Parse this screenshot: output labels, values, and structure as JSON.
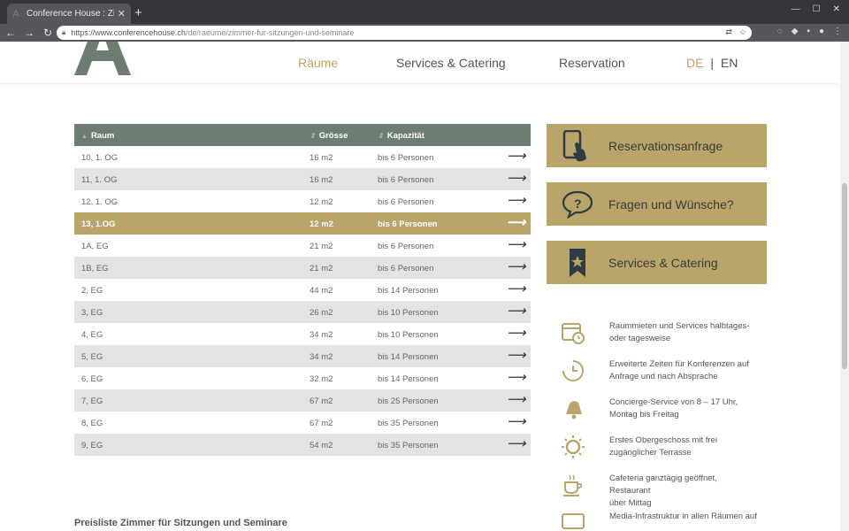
{
  "browser": {
    "tab_title": "Conference House : Zimm",
    "url_host": "https://www.conferencehouse.ch",
    "url_path": "/de/raeume/zimmer-fur-sitzungen-und-seminare"
  },
  "nav": {
    "items": [
      "Räume",
      "Services & Catering",
      "Reservation"
    ],
    "lang_de": "DE",
    "lang_sep": "|",
    "lang_en": "EN"
  },
  "table": {
    "headers": [
      "Raum",
      "Grösse",
      "Kapazität"
    ],
    "rows": [
      {
        "raum": "10, 1. OG",
        "groesse": "16 m2",
        "kapazitaet": "bis 6 Personen"
      },
      {
        "raum": "11, 1. OG",
        "groesse": "16 m2",
        "kapazitaet": "bis 6 Personen"
      },
      {
        "raum": "12, 1. OG",
        "groesse": "12 m2",
        "kapazitaet": "bis 6 Personen"
      },
      {
        "raum": "13, 1.OG",
        "groesse": "12 m2",
        "kapazitaet": "bis 6 Personen"
      },
      {
        "raum": "1A, EG",
        "groesse": "21 m2",
        "kapazitaet": "bis 6 Personen"
      },
      {
        "raum": "1B, EG",
        "groesse": "21 m2",
        "kapazitaet": "bis 6 Personen"
      },
      {
        "raum": "2, EG",
        "groesse": "44 m2",
        "kapazitaet": "bis 14 Personen"
      },
      {
        "raum": "3, EG",
        "groesse": "26 m2",
        "kapazitaet": "bis 10 Personen"
      },
      {
        "raum": "4, EG",
        "groesse": "34 m2",
        "kapazitaet": "bis 10 Personen"
      },
      {
        "raum": "5, EG",
        "groesse": "34 m2",
        "kapazitaet": "bis 14 Personen"
      },
      {
        "raum": "6, EG",
        "groesse": "32 m2",
        "kapazitaet": "bis 14 Personen"
      },
      {
        "raum": "7, EG",
        "groesse": "67 m2",
        "kapazitaet": "bis 25 Personen"
      },
      {
        "raum": "8, EG",
        "groesse": "67 m2",
        "kapazitaet": "bis 35 Personen"
      },
      {
        "raum": "9, EG",
        "groesse": "54 m2",
        "kapazitaet": "bis 35 Personen"
      }
    ]
  },
  "price_title": "Preisliste Zimmer für Sitzungen und Seminare",
  "cards": [
    {
      "label": "Reservationsanfrage",
      "icon": "touch-phone-icon"
    },
    {
      "label": "Fragen und Wünsche?",
      "icon": "question-bubble-icon"
    },
    {
      "label": "Services & Catering",
      "icon": "bookmark-star-icon"
    }
  ],
  "features": [
    {
      "icon": "calendar-clock-icon",
      "line1": "Raummieten und Services halbtages-",
      "line2": "oder tagesweise"
    },
    {
      "icon": "clock-icon",
      "line1": "Erweiterte Zeiten für Konferenzen auf",
      "line2": "Anfrage und nach Absprache"
    },
    {
      "icon": "bell-icon",
      "line1": "Concierge-Service von 8 – 17 Uhr,",
      "line2": "Montag bis Freitag"
    },
    {
      "icon": "sun-icon",
      "line1": "Erstes Obergeschoss mit frei",
      "line2": "zugänglicher Terrasse"
    },
    {
      "icon": "coffee-cup-icon",
      "line1": "Cafeteria ganztägig geöffnet, Restaurant",
      "line2": "über Mittag"
    },
    {
      "icon": "screen-icon",
      "line1": "Media-Infrastruktur in allen Räumen auf",
      "line2": ""
    }
  ],
  "colors": {
    "gold": "#b9a46a",
    "header_green": "#6e7d72"
  }
}
